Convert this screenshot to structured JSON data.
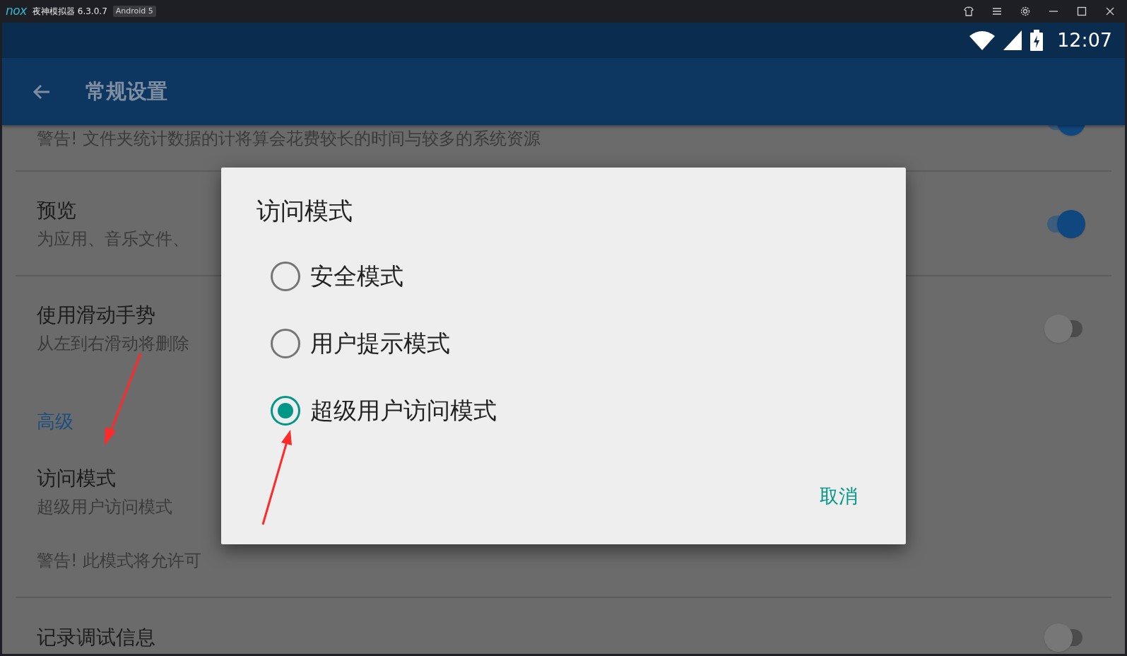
{
  "emulator": {
    "logo": "nox",
    "title": "夜神模拟器 6.3.0.7",
    "badge": "Android 5"
  },
  "status_bar": {
    "time": "12:07"
  },
  "toolbar": {
    "title": "常规设置"
  },
  "settings": [
    {
      "kind": "toggle",
      "summary": "警告! 文件夹统计数据的计将算会花费较长的时间与较多的系统资源",
      "on": true
    },
    {
      "kind": "toggle",
      "title": "预览",
      "summary": "为应用、音乐文件、",
      "on": true
    },
    {
      "kind": "toggle",
      "title": "使用滑动手势",
      "summary": "从左到右滑动将删除",
      "on": false
    },
    {
      "kind": "header",
      "label": "高级"
    },
    {
      "kind": "info",
      "title": "访问模式",
      "summary": "超级用户访问模式",
      "note": "警告! 此模式将允许可"
    },
    {
      "kind": "toggle",
      "title": "记录调试信息",
      "on": false
    }
  ],
  "dialog": {
    "title": "访问模式",
    "options": [
      {
        "label": "安全模式",
        "selected": false
      },
      {
        "label": "用户提示模式",
        "selected": false
      },
      {
        "label": "超级用户访问模式",
        "selected": true
      }
    ],
    "buttons": [
      "取消"
    ]
  }
}
